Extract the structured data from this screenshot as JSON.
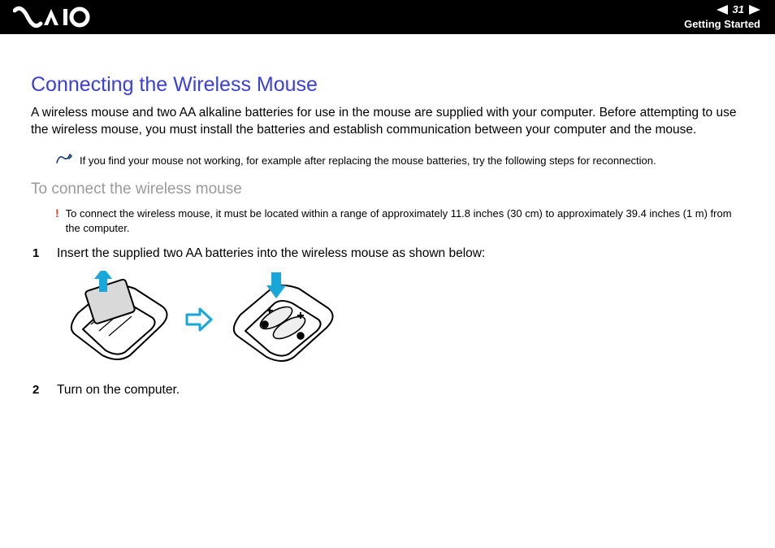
{
  "header": {
    "page_number": "31",
    "section": "Getting Started"
  },
  "title": "Connecting the Wireless Mouse",
  "intro": "A wireless mouse and two AA alkaline batteries for use in the mouse are supplied with your computer. Before attempting to use the wireless mouse, you must install the batteries and establish communication between your computer and the mouse.",
  "note": "If you find your mouse not working, for example after replacing the mouse batteries, try the following steps for reconnection.",
  "subheading": "To connect the wireless mouse",
  "warning_mark": "!",
  "warning": "To connect the wireless mouse, it must be located within a range of approximately 11.8 inches (30 cm) to approximately 39.4 inches (1 m) from the computer.",
  "steps": [
    {
      "num": "1",
      "text": "Insert the supplied two AA batteries into the wireless mouse as shown below:"
    },
    {
      "num": "2",
      "text": "Turn on the computer."
    }
  ]
}
